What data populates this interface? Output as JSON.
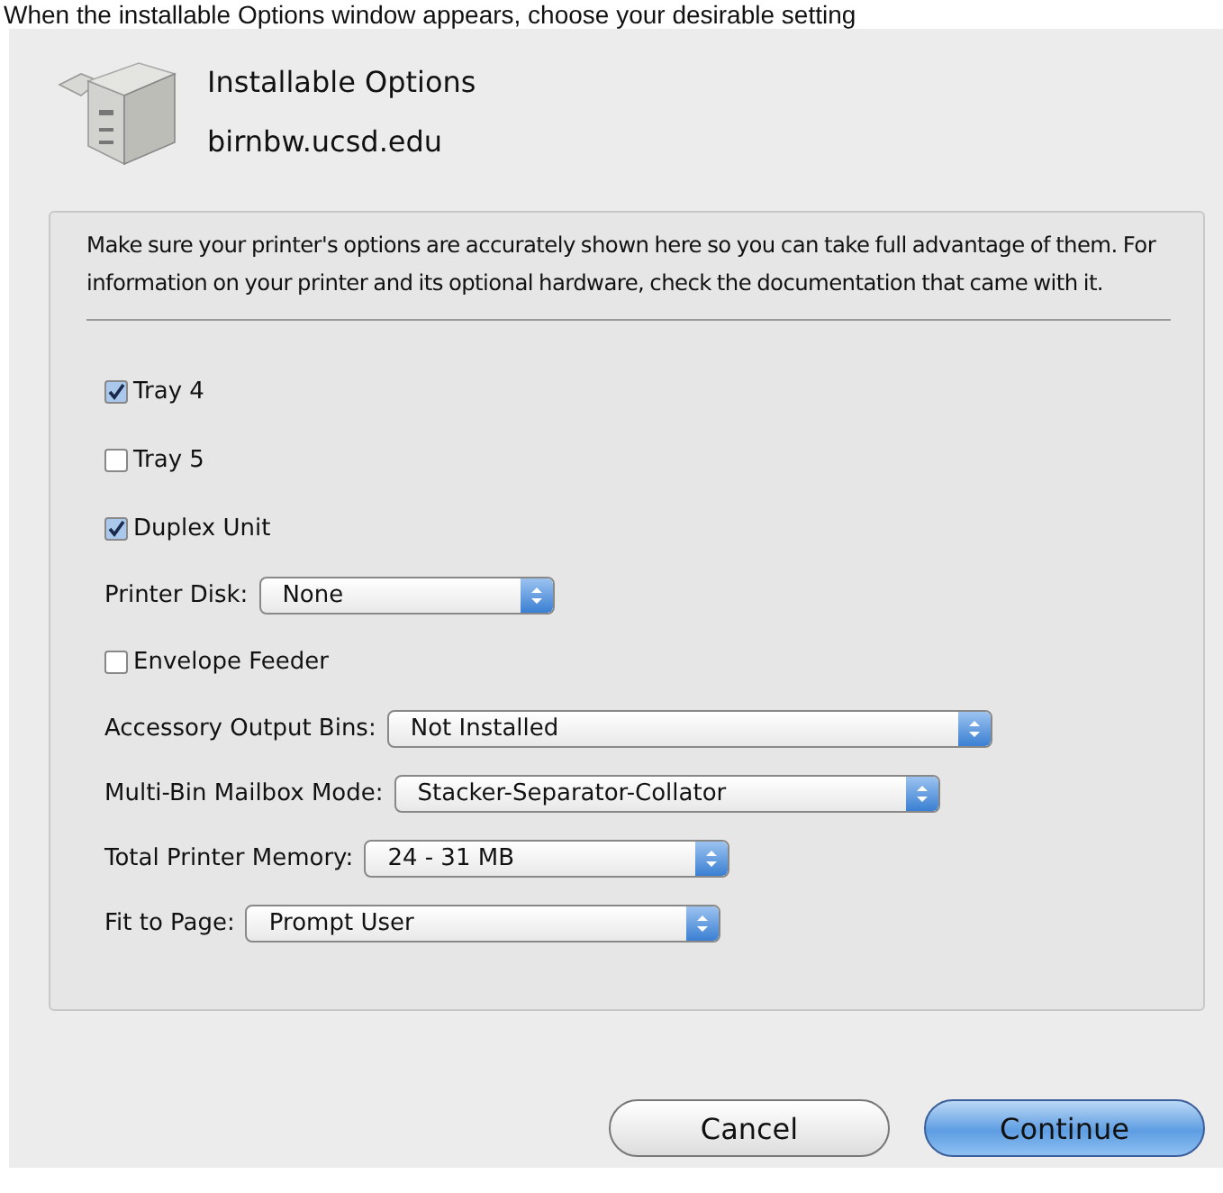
{
  "caption": "When the installable Options window appears, choose your desirable setting",
  "dialog": {
    "title": "Installable Options",
    "subtitle": "birnbw.ucsd.edu",
    "message": "Make sure your printer's options are accurately shown here so you can take full advantage of them.  For information on your printer and its optional hardware, check the documentation that came with it.",
    "options": [
      {
        "kind": "checkbox",
        "label": "Tray 4",
        "checked": true
      },
      {
        "kind": "checkbox",
        "label": "Tray 5",
        "checked": false
      },
      {
        "kind": "checkbox",
        "label": "Duplex Unit",
        "checked": true
      },
      {
        "kind": "popup",
        "label": "Printer Disk:",
        "value": "None"
      },
      {
        "kind": "checkbox",
        "label": "Envelope Feeder",
        "checked": false
      },
      {
        "kind": "popup",
        "label": "Accessory Output Bins:",
        "value": "Not Installed"
      },
      {
        "kind": "popup",
        "label": "Multi-Bin Mailbox Mode:",
        "value": "Stacker-Separator-Collator"
      },
      {
        "kind": "popup",
        "label": "Total Printer Memory:",
        "value": "24 - 31 MB"
      },
      {
        "kind": "popup",
        "label": "Fit to Page:",
        "value": "Prompt User"
      }
    ],
    "buttons": [
      {
        "label": "Cancel",
        "default": false
      },
      {
        "label": "Continue",
        "default": true
      }
    ]
  }
}
